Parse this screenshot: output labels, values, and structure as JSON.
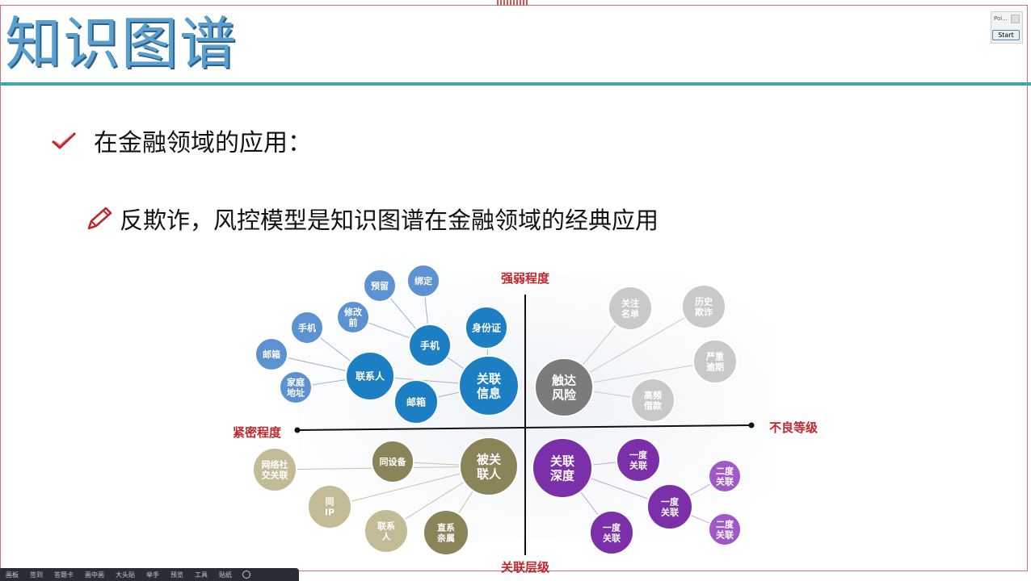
{
  "slide": {
    "title": "知识图谱",
    "bullet1": "在金融领域的应用：",
    "bullet2": "反欺诈，风控模型是知识图谱在金融领域的经典应用"
  },
  "widget": {
    "name": "Poi...",
    "start_label": "Start"
  },
  "diagram": {
    "axes": {
      "top": "强弱程度",
      "bottom": "关联层级",
      "left": "紧密程度",
      "right": "不良等级"
    },
    "quadrant_top_left": {
      "hub": [
        "关联",
        "信息"
      ],
      "groups": [
        {
          "node": "手机",
          "leaves": [
            [
              "预留"
            ],
            [
              "绑定"
            ],
            [
              "修改",
              "前"
            ]
          ]
        },
        {
          "node": "身份证",
          "leaves": []
        },
        {
          "node": "联系人",
          "leaves": [
            [
              "手机"
            ],
            [
              "邮箱"
            ],
            [
              "家庭",
              "地址"
            ]
          ]
        },
        {
          "node": "邮箱",
          "leaves": []
        }
      ]
    },
    "quadrant_top_right": {
      "hub": [
        "触达",
        "风险"
      ],
      "leaves": [
        [
          "关注",
          "名单"
        ],
        [
          "历史",
          "欺诈"
        ],
        [
          "严重",
          "逾期"
        ],
        [
          "高频",
          "借款"
        ]
      ]
    },
    "quadrant_bottom_left": {
      "hub": [
        "被关",
        "联人"
      ],
      "leaves": [
        [
          "同设备"
        ],
        [
          "网络社",
          "交关联"
        ],
        [
          "同",
          "IP"
        ],
        [
          "联系",
          "人"
        ],
        [
          "直系",
          "亲属"
        ]
      ]
    },
    "quadrant_bottom_right": {
      "hub": [
        "关联",
        "深度"
      ],
      "leaves": [
        [
          "一度",
          "关联"
        ],
        [
          "一度",
          "关联"
        ],
        [
          "一度",
          "关联"
        ],
        [
          "二度",
          "关联"
        ],
        [
          "二度",
          "关联"
        ]
      ]
    }
  },
  "taskbar": {
    "items": [
      "画板",
      "签到",
      "答题卡",
      "画中画",
      "大头贴",
      "举手",
      "预览",
      "工具",
      "贴纸"
    ]
  },
  "colors": {
    "title": "#5b9fcf",
    "rule": "#3aaaa3",
    "frame": "#e26a76",
    "axis_label": "#c0272d",
    "blue": "#1c7fc4",
    "blue_light": "#5d92d2",
    "gray": "#7b7b7b",
    "gray_light": "#c9c9c9",
    "olive": "#8a8458",
    "olive_light": "#c2bb95",
    "purple": "#7b2fa8",
    "purple_light": "#a058c8"
  },
  "icons": {
    "bullet1": "check-icon",
    "bullet2": "pencil-icon",
    "taskbar_end": "power-icon"
  }
}
